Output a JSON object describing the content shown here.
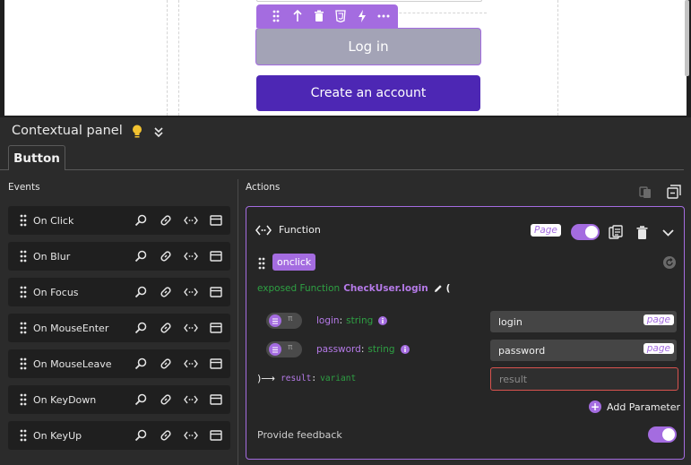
{
  "canvas": {
    "login_button": "Log in",
    "create_button": "Create an account"
  },
  "panel": {
    "title": "Contextual panel",
    "tab": "Button"
  },
  "events": {
    "label": "Events",
    "items": [
      {
        "label": "On Click"
      },
      {
        "label": "On Blur"
      },
      {
        "label": "On Focus"
      },
      {
        "label": "On MouseEnter"
      },
      {
        "label": "On MouseLeave"
      },
      {
        "label": "On KeyDown"
      },
      {
        "label": "On KeyUp"
      }
    ]
  },
  "actions": {
    "label": "Actions",
    "function": {
      "title": "Function",
      "scope_badge": "Page",
      "enabled": true,
      "trigger": "onclick",
      "signature": {
        "keyword": "exposed Function",
        "name": "CheckUser.login",
        "open_paren": "("
      },
      "params": [
        {
          "name": "login",
          "colon": ":",
          "type": "string",
          "value": "login",
          "badge": "page",
          "pi": "π"
        },
        {
          "name": "password",
          "colon": ":",
          "type": "string",
          "value": "password",
          "badge": "page",
          "pi": "π"
        }
      ],
      "return": {
        "arrow": ")⟶",
        "name": "result",
        "colon": ":",
        "type": "variant",
        "placeholder": "result"
      },
      "add_parameter": "Add Parameter",
      "feedback_label": "Provide feedback",
      "feedback_enabled": true
    }
  },
  "colors": {
    "accent": "#a46ce0",
    "primary_button": "#4d27b4",
    "disabled_button": "#a3a3b6",
    "keyword_green": "#2ea043",
    "error_border": "#d9534f"
  }
}
